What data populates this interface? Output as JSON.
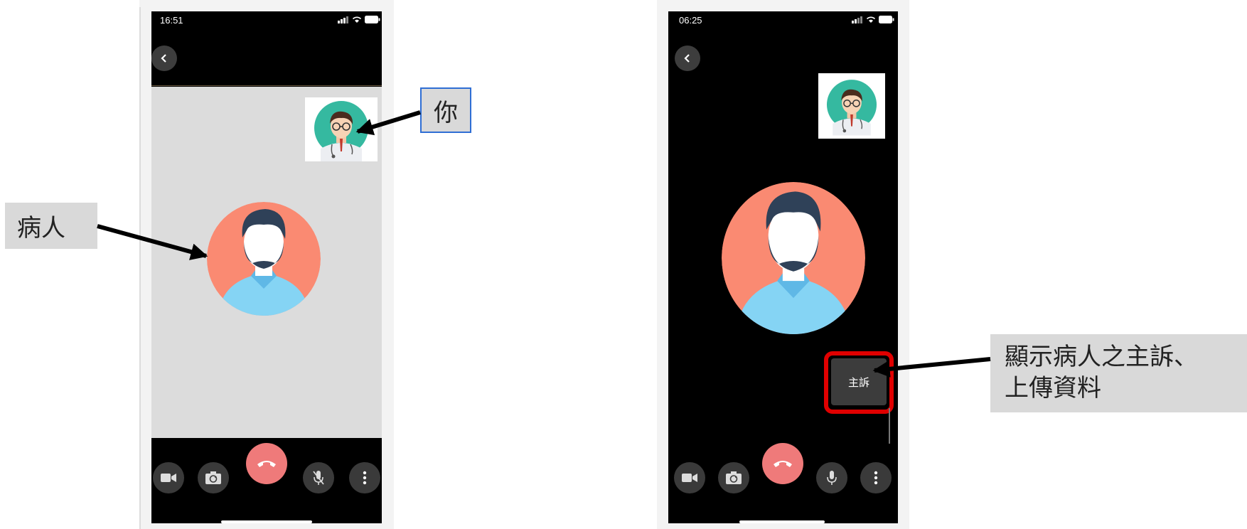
{
  "left_phone": {
    "status_time": "16:51",
    "role_label": "你",
    "patient_label": "病人"
  },
  "right_phone": {
    "status_time": "06:25",
    "complaint_button_label": "主訴",
    "annotation_label_line1": "顯示病人之主訴、",
    "annotation_label_line2": "上傳資料"
  },
  "colors": {
    "end_call": "#ef7a7a",
    "highlight": "#e00000",
    "patient_avatar_bg": "#fa8a72",
    "doctor_avatar_bg": "#35b9a0"
  },
  "icons": [
    "back-icon",
    "video-icon",
    "camera-switch-icon",
    "end-call-icon",
    "mic-off-icon",
    "mic-icon",
    "more-icon",
    "signal-icon",
    "wifi-icon",
    "battery-icon"
  ]
}
